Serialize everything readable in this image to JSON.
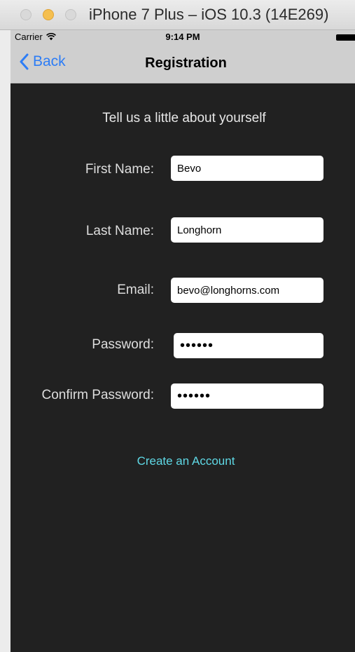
{
  "window": {
    "title": "iPhone 7 Plus – iOS 10.3 (14E269)"
  },
  "status_bar": {
    "carrier": "Carrier",
    "time": "9:14 PM"
  },
  "nav_bar": {
    "back_label": "Back",
    "title": "Registration"
  },
  "form": {
    "intro": "Tell us a little about yourself",
    "fields": [
      {
        "label": "First Name:",
        "value": "Bevo"
      },
      {
        "label": "Last Name:",
        "value": "Longhorn"
      },
      {
        "label": "Email:",
        "value": "bevo@longhorns.com"
      },
      {
        "label": "Password:",
        "value": "••••••"
      },
      {
        "label": "Confirm Password:",
        "value": "••••••"
      }
    ],
    "submit_label": "Create an Account"
  },
  "colors": {
    "screen_background": "#212121",
    "bar_background": "#cfcfcf",
    "back_tint": "#2d7df6",
    "link_color": "#5fd9e6"
  }
}
